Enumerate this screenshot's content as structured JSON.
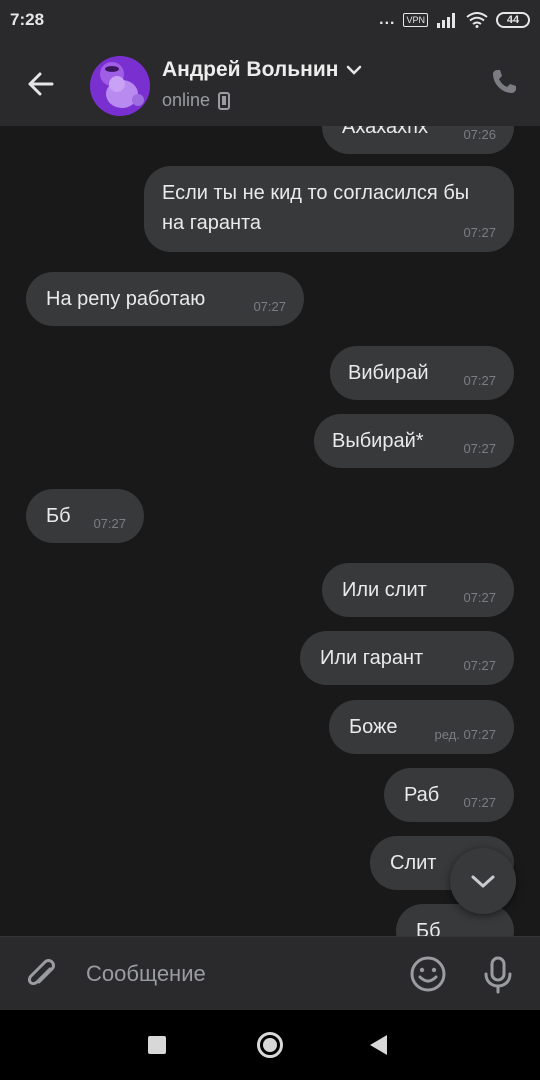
{
  "status_bar": {
    "time": "7:28",
    "dots": "...",
    "vpn": "VPN",
    "battery": "44"
  },
  "header": {
    "contact_name": "Андрей Вольнин",
    "status": "online",
    "icons": [
      "back-arrow-icon",
      "chevron-down-icon",
      "mobile-phone-icon",
      "phone-icon"
    ]
  },
  "messages": [
    {
      "text": "Ахахахпх",
      "time": "07:26",
      "direction": "outgoing"
    },
    {
      "text": "Если ты не кид то согласился бы на гаранта",
      "time": "07:27",
      "direction": "outgoing"
    },
    {
      "text": "На репу работаю",
      "time": "07:27",
      "direction": "incoming"
    },
    {
      "text": "Вибирай",
      "time": "07:27",
      "direction": "outgoing"
    },
    {
      "text": "Выбирай*",
      "time": "07:27",
      "direction": "outgoing"
    },
    {
      "text": "Бб",
      "time": "07:27",
      "direction": "incoming"
    },
    {
      "text": "Или слит",
      "time": "07:27",
      "direction": "outgoing"
    },
    {
      "text": "Или гарант",
      "time": "07:27",
      "direction": "outgoing"
    },
    {
      "text": "Боже",
      "time": "ред. 07:27",
      "direction": "outgoing"
    },
    {
      "text": "Раб",
      "time": "07:27",
      "direction": "outgoing"
    },
    {
      "text": "Слит",
      "time": "",
      "direction": "outgoing"
    },
    {
      "text": "Бб",
      "time": "",
      "direction": "outgoing"
    }
  ],
  "composer": {
    "placeholder": "Сообщение"
  },
  "colors": {
    "background": "#19191a",
    "header": "#2a2a2c",
    "bubble": "#38393b"
  }
}
